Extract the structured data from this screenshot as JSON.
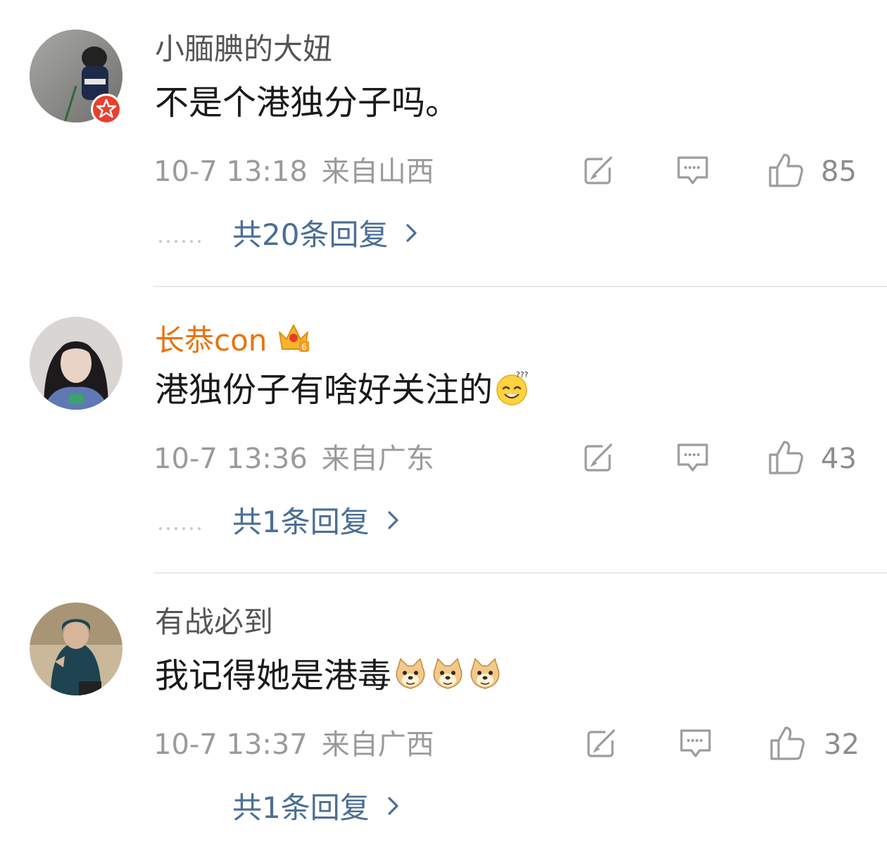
{
  "colors": {
    "username": "#555555",
    "vip_username": "#e8730c",
    "content": "#1a1a1a",
    "meta": "#9a9a9a",
    "reply_link": "#4a6e96",
    "divider": "#e9e9e9",
    "icon": "#9c9c9c"
  },
  "comments": [
    {
      "username": "小腼腆的大妞",
      "vip": false,
      "has_badge": true,
      "content": "不是个港独分子吗。",
      "time": "10-7 13:18",
      "location": "来自山西",
      "likes": "85",
      "replies_label": "共20条回复",
      "show_dots": true,
      "emojis": []
    },
    {
      "username": "长恭con",
      "vip": true,
      "has_badge": false,
      "content": "港独份子有啥好关注的",
      "time": "10-7 13:36",
      "location": "来自广东",
      "likes": "43",
      "replies_label": "共1条回复",
      "show_dots": true,
      "emojis": [
        "dizzy-smile-emoji"
      ]
    },
    {
      "username": "有战必到",
      "vip": false,
      "has_badge": false,
      "content": "我记得她是港毒",
      "time": "10-7 13:37",
      "location": "来自广西",
      "likes": "32",
      "replies_label": "共1条回复",
      "show_dots": false,
      "emojis": [
        "doge-emoji",
        "doge-emoji",
        "doge-emoji"
      ]
    }
  ],
  "icons": {
    "share": "share-icon",
    "reply": "comment-icon",
    "like": "thumbs-up-icon",
    "chevron": "chevron-right-icon",
    "crown": "vip-crown-icon"
  }
}
